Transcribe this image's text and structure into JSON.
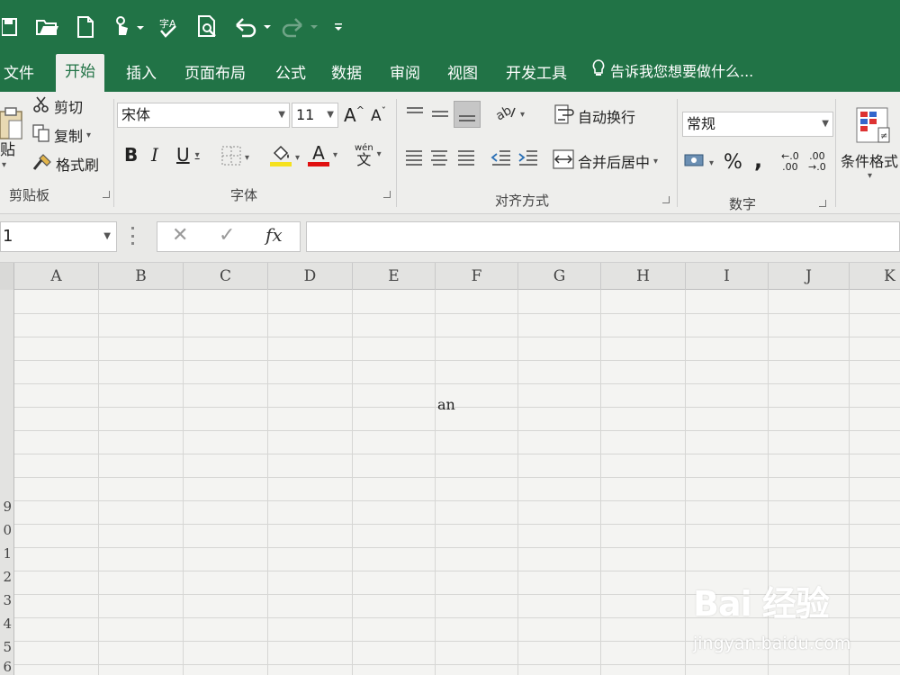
{
  "qat": {
    "icons": [
      "save-icon",
      "open-icon",
      "new-icon",
      "touch-mode-icon",
      "spelling-icon",
      "print-preview-icon",
      "undo-icon",
      "redo-icon",
      "customize-icon"
    ]
  },
  "tabs": [
    {
      "label": "文件",
      "active": false
    },
    {
      "label": "开始",
      "active": true
    },
    {
      "label": "插入",
      "active": false
    },
    {
      "label": "页面布局",
      "active": false
    },
    {
      "label": "公式",
      "active": false
    },
    {
      "label": "数据",
      "active": false
    },
    {
      "label": "审阅",
      "active": false
    },
    {
      "label": "视图",
      "active": false
    },
    {
      "label": "开发工具",
      "active": false
    }
  ],
  "tellme": "告诉我您想要做什么...",
  "clipboard": {
    "paste": "贴",
    "cut": "剪切",
    "copy": "复制",
    "format_painter": "格式刷",
    "label": "剪贴板"
  },
  "font": {
    "name": "宋体",
    "size": "11",
    "grow": "A",
    "shrink": "A",
    "bold": "B",
    "italic": "I",
    "underline": "U",
    "font_color": "A",
    "phonetic_top": "wén",
    "phonetic_bottom": "文",
    "label": "字体"
  },
  "alignment": {
    "wrap_text": "自动换行",
    "merge_center": "合并后居中",
    "label": "对齐方式"
  },
  "number": {
    "format": "常规",
    "percent": "%",
    "comma": ",",
    "inc_decimal_top": "←.0",
    "inc_decimal_bottom": ".00",
    "dec_decimal_top": ".00",
    "dec_decimal_bottom": "→.0",
    "label": "数字"
  },
  "styles": {
    "conditional_format": "条件格式"
  },
  "formula_bar": {
    "name_box": "1",
    "cancel": "✕",
    "enter": "✓",
    "fx": "fx",
    "value": ""
  },
  "sheet": {
    "columns": [
      "A",
      "B",
      "C",
      "D",
      "E",
      "F",
      "G",
      "H",
      "I",
      "J",
      "K"
    ],
    "rows": [
      "",
      "",
      "",
      "",
      "",
      "",
      "",
      "",
      "9",
      "0",
      "1",
      "2",
      "3",
      "4",
      "5",
      "6"
    ],
    "cell_value": "an"
  },
  "watermark": {
    "logo": "Bai 经验",
    "url": "jingyan.baidu.com"
  },
  "colors": {
    "excel_green": "#217346",
    "font_color_red": "#e01010",
    "highlight_yellow": "#f5e11e"
  }
}
